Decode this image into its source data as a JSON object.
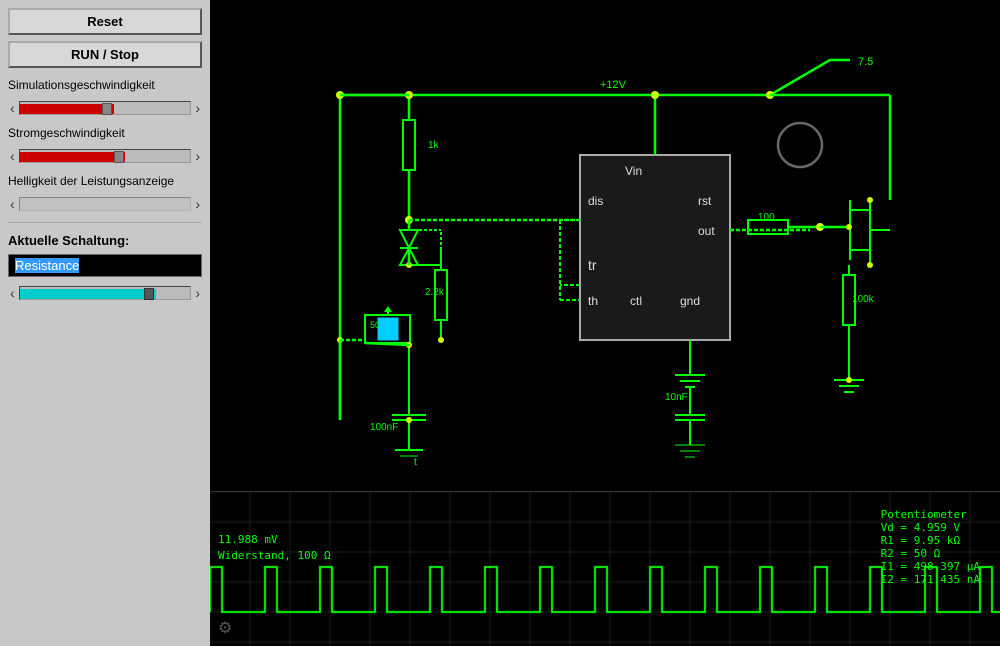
{
  "sidebar": {
    "reset_label": "Reset",
    "run_stop_label": "RUN / Stop",
    "sim_speed_label": "Simulationsgeschwindigkeit",
    "current_speed_label": "Stromgeschwindigkeit",
    "brightness_label": "Helligkeit der Leistungsanzeige",
    "current_circuit_label": "Aktuelle Schaltung:",
    "circuit_name": "Resistance",
    "left_arrow": "‹",
    "right_arrow": "›"
  },
  "bottom": {
    "voltage": "11.988 mV",
    "resistance": "Widerstand, 100 Ω",
    "potentiometer_header": "Potentiometer",
    "vd": "Vd = 4.959 V",
    "r1": "R1 = 9.95 kΩ",
    "r2": "R2 = 50 Ω",
    "i1": "I1 = 498.397 µA",
    "i2": "I2 = 171.435 nA"
  },
  "circuit": {
    "vin_label": "Vin",
    "dis_label": "dis",
    "rst_label": "rst",
    "out_label": "out",
    "tr_label": "tr",
    "ctl_label": "ctl",
    "gnd_label": "gnd",
    "r1k": "1k",
    "r2_2k": "2.2k",
    "r50": "50",
    "r100k": "100k",
    "r100": "100",
    "c100nf": "100nF",
    "c10nf": "10nF",
    "v12": "+12V",
    "v7_5": "7.5"
  },
  "icons": {
    "gear": "⚙"
  }
}
